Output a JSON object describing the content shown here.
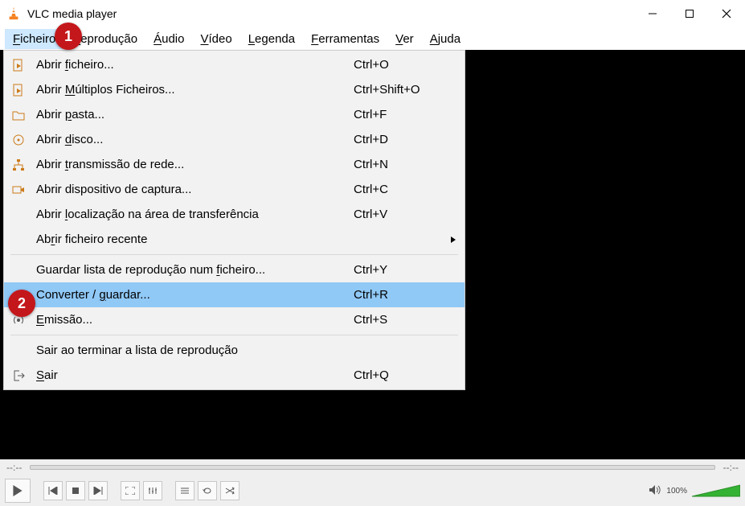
{
  "window": {
    "title": "VLC media player"
  },
  "menu": {
    "items": [
      "Ficheiro",
      "Reprodução",
      "Áudio",
      "Vídeo",
      "Legenda",
      "Ferramentas",
      "Ver",
      "Ajuda"
    ],
    "accel": [
      "F",
      "R",
      "Á",
      "V",
      "L",
      "F",
      "V",
      "A"
    ]
  },
  "dropdown": {
    "rows": [
      {
        "icon": "file-video",
        "label": "Abrir ficheiro...",
        "acc": "f",
        "short": "Ctrl+O"
      },
      {
        "icon": "file-video",
        "label": "Abrir Múltiplos Ficheiros...",
        "acc": "M",
        "short": "Ctrl+Shift+O"
      },
      {
        "icon": "folder",
        "label": "Abrir pasta...",
        "acc": "p",
        "short": "Ctrl+F"
      },
      {
        "icon": "disc",
        "label": "Abrir disco...",
        "acc": "d",
        "short": "Ctrl+D"
      },
      {
        "icon": "net",
        "label": "Abrir transmissão de rede...",
        "acc": "t",
        "short": "Ctrl+N"
      },
      {
        "icon": "capture",
        "label": "Abrir dispositivo de captura...",
        "acc": "",
        "short": "Ctrl+C"
      },
      {
        "icon": "",
        "label": "Abrir localização na área de transferência",
        "acc": "l",
        "short": "Ctrl+V"
      },
      {
        "icon": "",
        "label": "Abrir ficheiro recente",
        "acc": "r",
        "short": "",
        "submenu": true
      },
      {
        "sep": true
      },
      {
        "icon": "",
        "label": "Guardar lista de reprodução num ficheiro...",
        "acc": "f",
        "short": "Ctrl+Y"
      },
      {
        "icon": "",
        "label": "Converter / guardar...",
        "acc": "g",
        "short": "Ctrl+R",
        "hl": true
      },
      {
        "icon": "stream",
        "label": "Emissão...",
        "acc": "E",
        "short": "Ctrl+S"
      },
      {
        "sep": true
      },
      {
        "icon": "",
        "label": "Sair ao terminar a lista de reprodução",
        "acc": "",
        "short": ""
      },
      {
        "icon": "quit",
        "label": "Sair",
        "acc": "S",
        "short": "Ctrl+Q"
      }
    ]
  },
  "time": {
    "current": "--:--",
    "total": "--:--"
  },
  "volume": {
    "label": "100%"
  },
  "badges": {
    "b1": "1",
    "b2": "2"
  }
}
